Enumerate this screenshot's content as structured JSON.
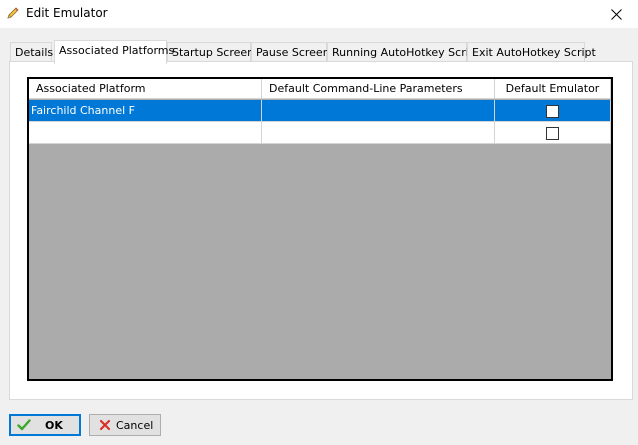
{
  "window": {
    "title": "Edit Emulator",
    "close_glyph": "✕"
  },
  "tabs": [
    {
      "label": "Details"
    },
    {
      "label": "Associated Platforms"
    },
    {
      "label": "Startup Screen"
    },
    {
      "label": "Pause Screen"
    },
    {
      "label": "Running AutoHotkey Script"
    },
    {
      "label": "Exit AutoHotkey Script"
    }
  ],
  "active_tab": "Associated Platforms",
  "grid": {
    "columns": [
      "Associated Platform",
      "Default Command-Line Parameters",
      "Default Emulator"
    ],
    "rows": [
      {
        "platform": "Fairchild Channel F",
        "params": "",
        "default_emulator": false,
        "selected": true
      },
      {
        "platform": "",
        "params": "",
        "default_emulator": false,
        "selected": false
      }
    ]
  },
  "buttons": {
    "ok": "OK",
    "cancel": "Cancel"
  },
  "colors": {
    "selection": "#0078d7",
    "empty_area": "#ababab",
    "ok_check": "#3aa829",
    "cancel_x": "#d9302a"
  }
}
